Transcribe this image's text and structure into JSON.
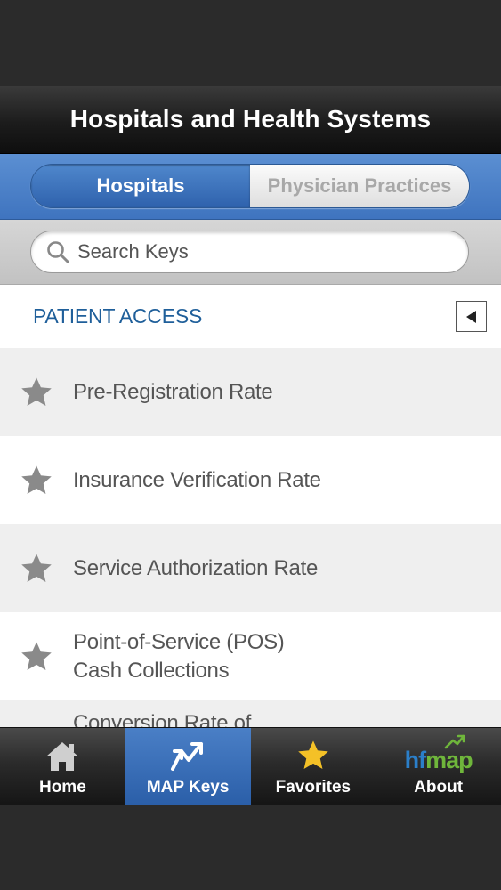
{
  "header": {
    "title": "Hospitals and Health Systems"
  },
  "segments": {
    "active": "Hospitals",
    "inactive": "Physician Practices"
  },
  "search": {
    "placeholder": "Search Keys"
  },
  "section": {
    "title": "PATIENT ACCESS"
  },
  "list": {
    "items": [
      {
        "label": "Pre-Registration Rate"
      },
      {
        "label": "Insurance Verification Rate"
      },
      {
        "label": "Service Authorization Rate"
      },
      {
        "label_line1": "Point-of-Service (POS)",
        "label_line2": "Cash Collections"
      },
      {
        "label": "Conversion Rate of"
      }
    ]
  },
  "tabs": {
    "home": {
      "label": "Home",
      "icon": "home-icon"
    },
    "map_keys": {
      "label": "MAP Keys",
      "icon": "arrows-icon"
    },
    "favorites": {
      "label": "Favorites",
      "icon": "star-icon"
    },
    "about": {
      "label": "About",
      "logo_hf": "hf",
      "logo_map": "map"
    }
  },
  "colors": {
    "accent_blue": "#3f74bf",
    "section_blue": "#1f5f9a",
    "star_gray": "#8a8a8a",
    "favorites_star": "#f4c127",
    "logo_blue": "#2b7fc9",
    "logo_green": "#6fb63b"
  }
}
